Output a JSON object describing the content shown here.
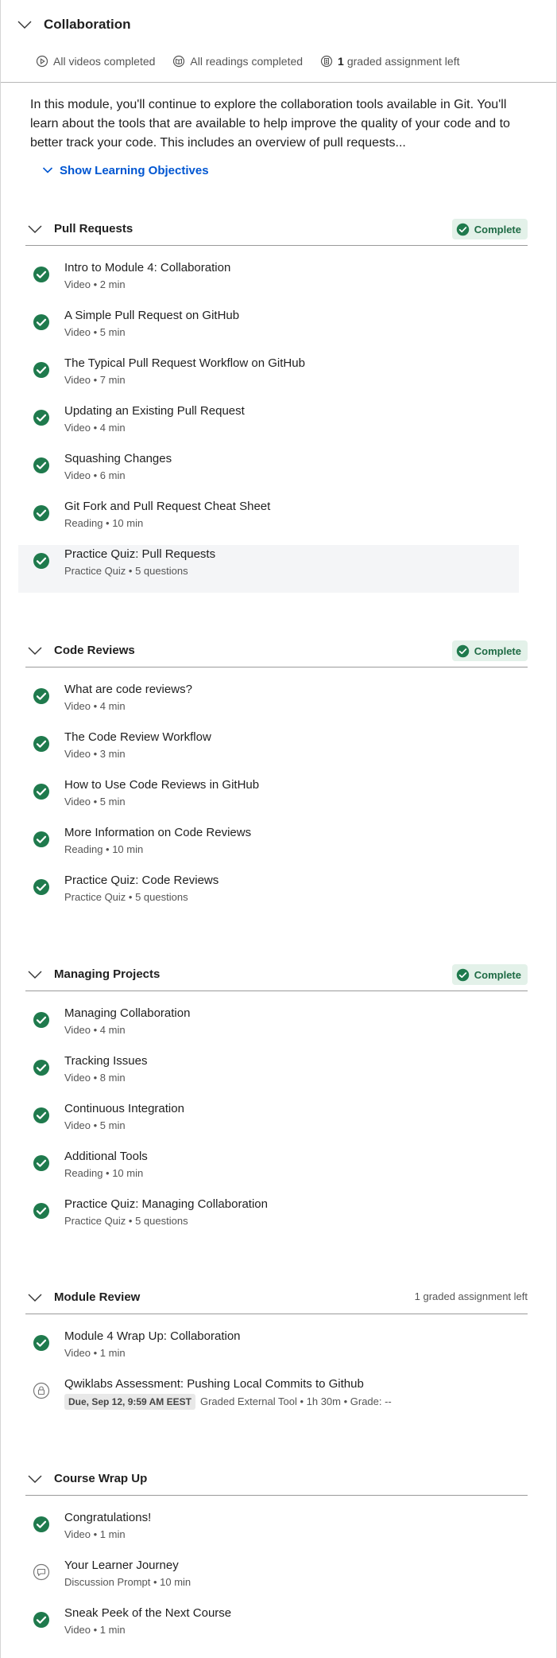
{
  "module": {
    "title": "Collaboration",
    "status": {
      "videos": "All videos completed",
      "readings": "All readings completed",
      "graded_count": "1",
      "graded_text": "graded assignment left"
    },
    "description": "In this module, you'll continue to explore the collaboration tools available in Git. You'll learn about the tools that are available to help improve the quality of your code and to better track your code. This includes an overview of pull requests...",
    "objectives_link": "Show Learning Objectives"
  },
  "colors": {
    "accent": "#0056d2",
    "complete_green": "#1f7a4d",
    "complete_bg": "#e3f1e9"
  },
  "sections": [
    {
      "title": "Pull Requests",
      "badge": "Complete",
      "items": [
        {
          "title": "Intro to Module 4: Collaboration",
          "meta": "Video • 2 min",
          "icon": "check-circle-icon"
        },
        {
          "title": "A Simple Pull Request on GitHub",
          "meta": "Video • 5 min",
          "icon": "check-circle-icon"
        },
        {
          "title": "The Typical Pull Request Workflow on GitHub",
          "meta": "Video • 7 min",
          "icon": "check-circle-icon"
        },
        {
          "title": "Updating an Existing Pull Request",
          "meta": "Video • 4 min",
          "icon": "check-circle-icon"
        },
        {
          "title": "Squashing Changes",
          "meta": "Video • 6 min",
          "icon": "check-circle-icon"
        },
        {
          "title": "Git Fork and Pull Request Cheat Sheet",
          "meta": "Reading • 10 min",
          "icon": "check-circle-icon"
        },
        {
          "title": "Practice Quiz: Pull Requests",
          "meta": "Practice Quiz • 5 questions",
          "icon": "check-circle-icon"
        }
      ]
    },
    {
      "title": "Code Reviews",
      "badge": "Complete",
      "items": [
        {
          "title": "What are code reviews?",
          "meta": "Video • 4 min",
          "icon": "check-circle-icon"
        },
        {
          "title": "The Code Review Workflow",
          "meta": "Video • 3 min",
          "icon": "check-circle-icon"
        },
        {
          "title": "How to Use Code Reviews in GitHub",
          "meta": "Video • 5 min",
          "icon": "check-circle-icon"
        },
        {
          "title": "More Information on Code Reviews",
          "meta": "Reading • 10 min",
          "icon": "check-circle-icon"
        },
        {
          "title": "Practice Quiz: Code Reviews",
          "meta": "Practice Quiz • 5 questions",
          "icon": "check-circle-icon"
        }
      ]
    },
    {
      "title": "Managing Projects",
      "badge": "Complete",
      "items": [
        {
          "title": "Managing Collaboration",
          "meta": "Video • 4 min",
          "icon": "check-circle-icon"
        },
        {
          "title": "Tracking Issues",
          "meta": "Video • 8 min",
          "icon": "check-circle-icon"
        },
        {
          "title": "Continuous Integration",
          "meta": "Video • 5 min",
          "icon": "check-circle-icon"
        },
        {
          "title": "Additional Tools",
          "meta": "Reading • 10 min",
          "icon": "check-circle-icon"
        },
        {
          "title": "Practice Quiz: Managing Collaboration",
          "meta": "Practice Quiz • 5 questions",
          "icon": "check-circle-icon"
        }
      ]
    },
    {
      "title": "Module Review",
      "note": "1 graded assignment left",
      "items": [
        {
          "title": "Module 4 Wrap Up: Collaboration",
          "meta": "Video • 1 min",
          "icon": "check-circle-icon"
        },
        {
          "title": "Qwiklabs Assessment: Pushing Local Commits to Github",
          "due": "Due, Sep 12, 9:59 AM EEST",
          "meta": "Graded External Tool • 1h 30m • Grade: --",
          "icon": "lock-icon"
        }
      ]
    },
    {
      "title": "Course Wrap Up",
      "items": [
        {
          "title": "Congratulations!",
          "meta": "Video • 1 min",
          "icon": "check-circle-icon"
        },
        {
          "title": "Your Learner Journey",
          "meta": "Discussion Prompt • 10 min",
          "icon": "chat-bubble-icon"
        },
        {
          "title": "Sneak Peek of the Next Course",
          "meta": "Video • 1 min",
          "icon": "check-circle-icon"
        }
      ]
    }
  ]
}
